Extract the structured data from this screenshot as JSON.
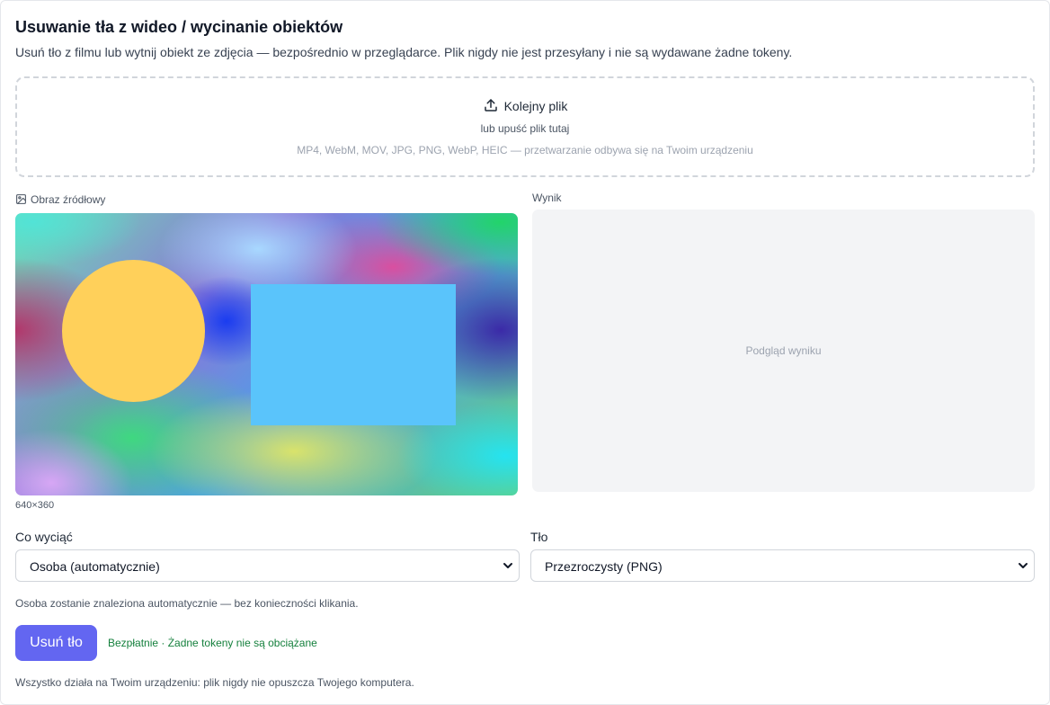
{
  "header": {
    "title": "Usuwanie tła z wideo / wycinanie obiektów",
    "subtitle": "Usuń tło z filmu lub wytnij obiekt ze zdjęcia — bezpośrednio w przeglądarce. Plik nigdy nie jest przesyłany i nie są wydawane żadne tokeny."
  },
  "dropzone": {
    "upload_icon": "upload-icon",
    "button_label": "Kolejny plik",
    "drop_hint": "lub upuść plik tutaj",
    "formats": "MP4, WebM, MOV, JPG, PNG, WebP, HEIC — przetwarzanie odbywa się na Twoim urządzeniu"
  },
  "source": {
    "label_icon": "image-icon",
    "label": "Obraz źródłowy",
    "dimensions": "640×360",
    "shape_colors": {
      "circle": "#ffd05a",
      "rectangle": "#5ac4fb"
    }
  },
  "result": {
    "label": "Wynik",
    "placeholder": "Podgląd wyniku"
  },
  "controls": {
    "cut_label": "Co wyciąć",
    "cut_selected": "Osoba (automatycznie)",
    "bg_label": "Tło",
    "bg_selected": "Przezroczysty (PNG)",
    "hint": "Osoba zostanie znaleziona automatycznie — bez konieczności klikania.",
    "run_button": "Usuń tło",
    "free_note": "Bezpłatnie · Żadne tokeny nie są obciążane"
  },
  "footer": {
    "note": "Wszystko działa na Twoim urządzeniu: plik nigdy nie opuszcza Twojego komputera."
  },
  "colors": {
    "accent": "#6366f1",
    "success_text": "#15803d"
  }
}
